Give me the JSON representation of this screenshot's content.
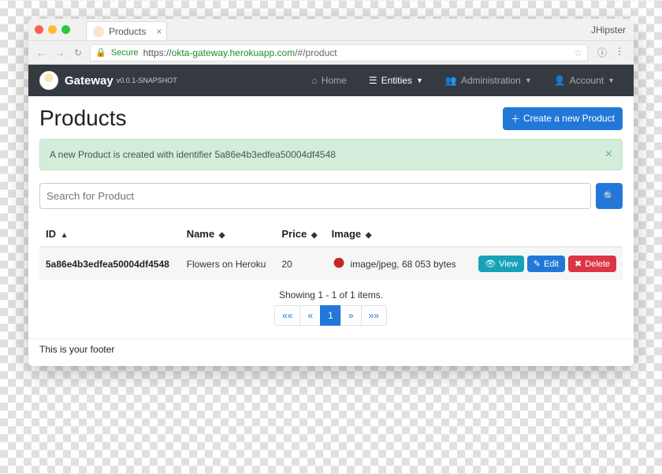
{
  "browser": {
    "tabTitle": "Products",
    "rightLabel": "JHipster",
    "secureLabel": "Secure",
    "urlProtocol": "https://",
    "urlHost": "okta-gateway.herokuapp.com",
    "urlPath": "/#/product"
  },
  "nav": {
    "brand": "Gateway",
    "version": "v0.0.1-SNAPSHOT",
    "home": "Home",
    "entities": "Entities",
    "admin": "Administration",
    "account": "Account"
  },
  "page": {
    "title": "Products",
    "createBtn": "Create a new Product",
    "alert": "A new Product is created with identifier 5a86e4b3edfea50004df4548",
    "searchPlaceholder": "Search for Product",
    "columns": {
      "id": "ID",
      "name": "Name",
      "price": "Price",
      "image": "Image"
    },
    "rows": [
      {
        "id": "5a86e4b3edfea50004df4548",
        "name": "Flowers on Heroku",
        "price": "20",
        "imageInfo": "image/jpeg, 68 053 bytes"
      }
    ],
    "actions": {
      "view": "View",
      "edit": "Edit",
      "delete": "Delete"
    },
    "showing": "Showing 1 - 1 of 1 items.",
    "pager": {
      "first": "««",
      "prev": "«",
      "current": "1",
      "next": "»",
      "last": "»»"
    }
  },
  "footer": "This is your footer"
}
